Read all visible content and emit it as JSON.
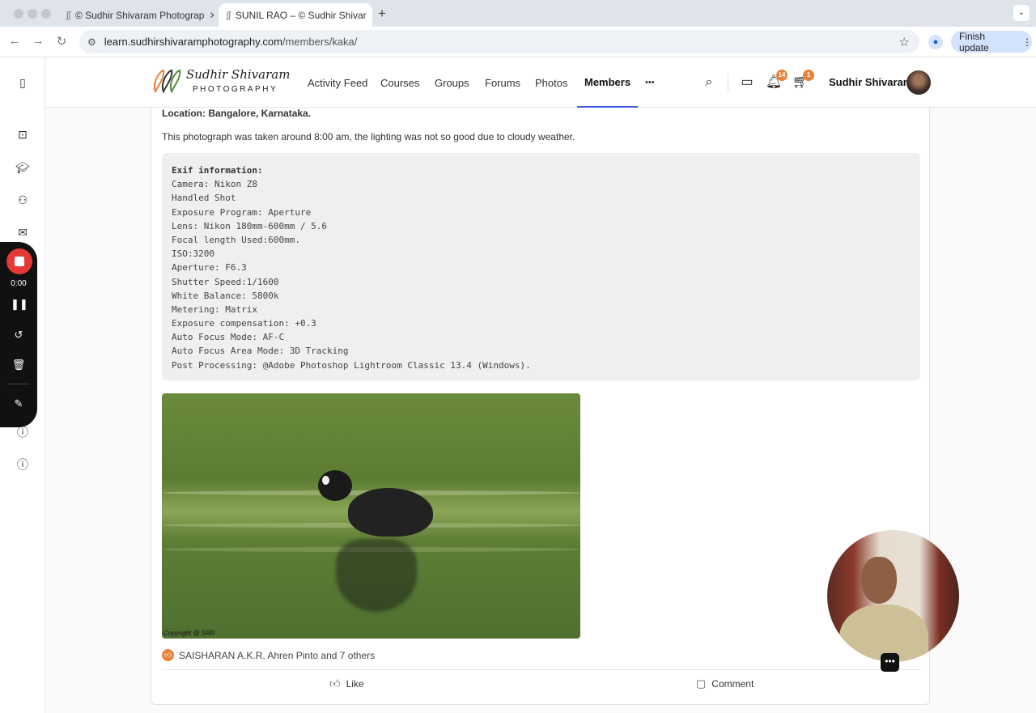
{
  "browser": {
    "tabs": [
      {
        "title": "© Sudhir Shivaram Photograp",
        "active": false
      },
      {
        "title": "SUNIL RAO – © Sudhir Shivar",
        "active": true
      }
    ],
    "url_host": "learn.sudhirshivaramphotography.com",
    "url_path": "/members/kaka/",
    "finish_update_label": "Finish update"
  },
  "site": {
    "logo_script": "Sudhir Shivaram",
    "logo_caps": "PHOTOGRAPHY",
    "nav": [
      "Activity Feed",
      "Courses",
      "Groups",
      "Forums",
      "Photos",
      "Members"
    ],
    "more_label": "•••",
    "active_nav": "Members",
    "notifications_count": "14",
    "cart_count": "1",
    "user_name": "Sudhir Shivaram"
  },
  "post": {
    "location": "Location: Bangalore, Karnataka.",
    "description": "This photograph was taken around 8:00 am, the lighting was not so good due to cloudy weather.",
    "exif_heading": "Exif information:",
    "exif_lines": [
      "Camera: Nikon Z8",
      "Handled Shot",
      "Exposure Program: Aperture",
      "Lens: Nikon 180mm-600mm / 5.6",
      "Focal length Used:600mm.",
      "ISO:3200",
      "Aperture: F6.3",
      "Shutter Speed:1/1600",
      "White Balance: 5800k",
      "Metering: Matrix",
      "Exposure compensation: +0.3",
      "Auto Focus Mode: AF-C",
      "Auto Focus Area Mode: 3D Tracking",
      "Post Processing: @Adobe Photoshop Lightroom Classic 13.4 (Windows)."
    ],
    "photo_copyright": "Copyright @ SRR",
    "likers": "SAISHARAN A.K.R, Ahren Pinto and 7 others",
    "like_label": "Like",
    "comment_label": "Comment"
  },
  "recorder": {
    "time": "0:00"
  },
  "colors": {
    "accent_badge": "#e8823c",
    "active_underline": "#3b5bdb",
    "record_red": "#e53935"
  }
}
